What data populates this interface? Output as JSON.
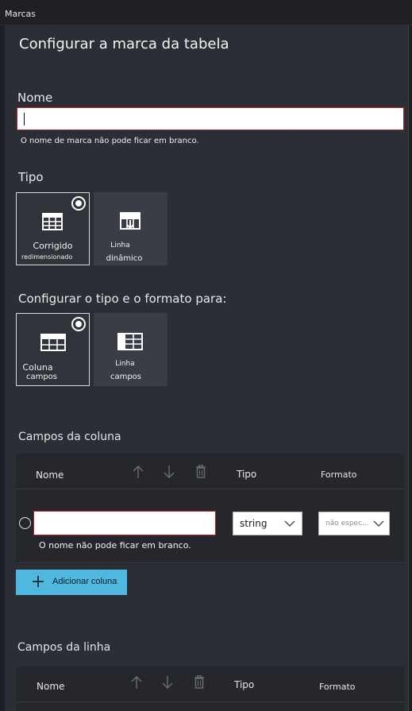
{
  "window": {
    "title": "Marcas"
  },
  "panel": {
    "title": "Configurar a marca da tabela"
  },
  "name_field": {
    "label": "Nome",
    "value": "",
    "error": "O nome de marca não pode ficar em branco."
  },
  "type_section": {
    "label": "Tipo",
    "options": [
      {
        "line1": "Corrigido",
        "line2": "redimensionado",
        "selected": true,
        "icon": "fixed-table-icon"
      },
      {
        "line1": "Linha",
        "line2": "dinâmico",
        "selected": false,
        "icon": "dynamic-row-table-icon"
      }
    ]
  },
  "format_section": {
    "label": "Configurar o tipo e o formato para:",
    "options": [
      {
        "line1": "Coluna",
        "line2": "campos",
        "selected": true,
        "icon": "column-fields-icon"
      },
      {
        "line1": "Linha",
        "line2": "campos",
        "selected": false,
        "icon": "row-fields-icon"
      }
    ]
  },
  "column_fields": {
    "title": "Campos da coluna",
    "headers": {
      "name": "Nome",
      "type": "Tipo",
      "format": "Formato"
    },
    "row": {
      "name_value": "",
      "name_error": "O nome não pode ficar em branco.",
      "type_value": "string",
      "format_value": "não espec..."
    },
    "add_button": "Adicionar coluna"
  },
  "row_fields": {
    "title": "Campos da linha",
    "headers": {
      "name": "Nome",
      "type": "Tipo",
      "format": "Formato"
    }
  },
  "colors": {
    "background": "#1e2025",
    "panel": "#2b2e35",
    "error_border": "#b2232b",
    "accent_button": "#4fb8de"
  }
}
